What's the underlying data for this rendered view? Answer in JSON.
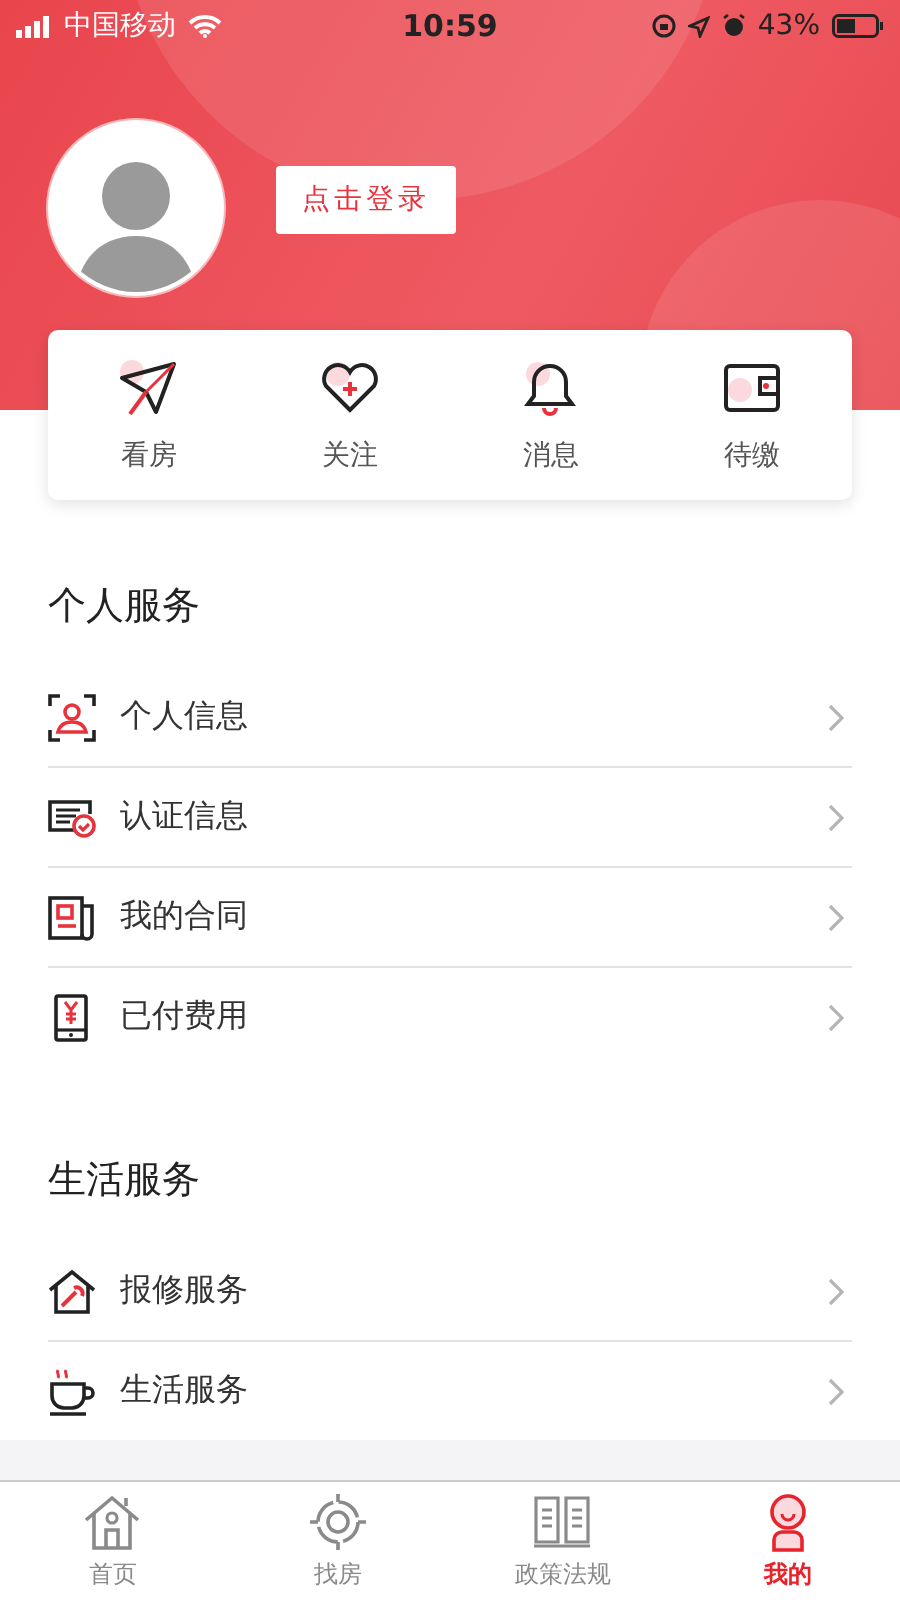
{
  "status_bar": {
    "carrier": "中国移动",
    "time": "10:59",
    "battery": "43%"
  },
  "profile": {
    "login_button": "点击登录"
  },
  "quick_actions": [
    {
      "label": "看房"
    },
    {
      "label": "关注"
    },
    {
      "label": "消息"
    },
    {
      "label": "待缴"
    }
  ],
  "sections": [
    {
      "title": "个人服务",
      "items": [
        {
          "label": "个人信息"
        },
        {
          "label": "认证信息"
        },
        {
          "label": "我的合同"
        },
        {
          "label": "已付费用"
        }
      ]
    },
    {
      "title": "生活服务",
      "items": [
        {
          "label": "报修服务"
        },
        {
          "label": "生活服务"
        }
      ]
    }
  ],
  "tab_bar": [
    {
      "label": "首页",
      "selected": false
    },
    {
      "label": "找房",
      "selected": false
    },
    {
      "label": "政策法规",
      "selected": false
    },
    {
      "label": "我的",
      "selected": true
    }
  ]
}
